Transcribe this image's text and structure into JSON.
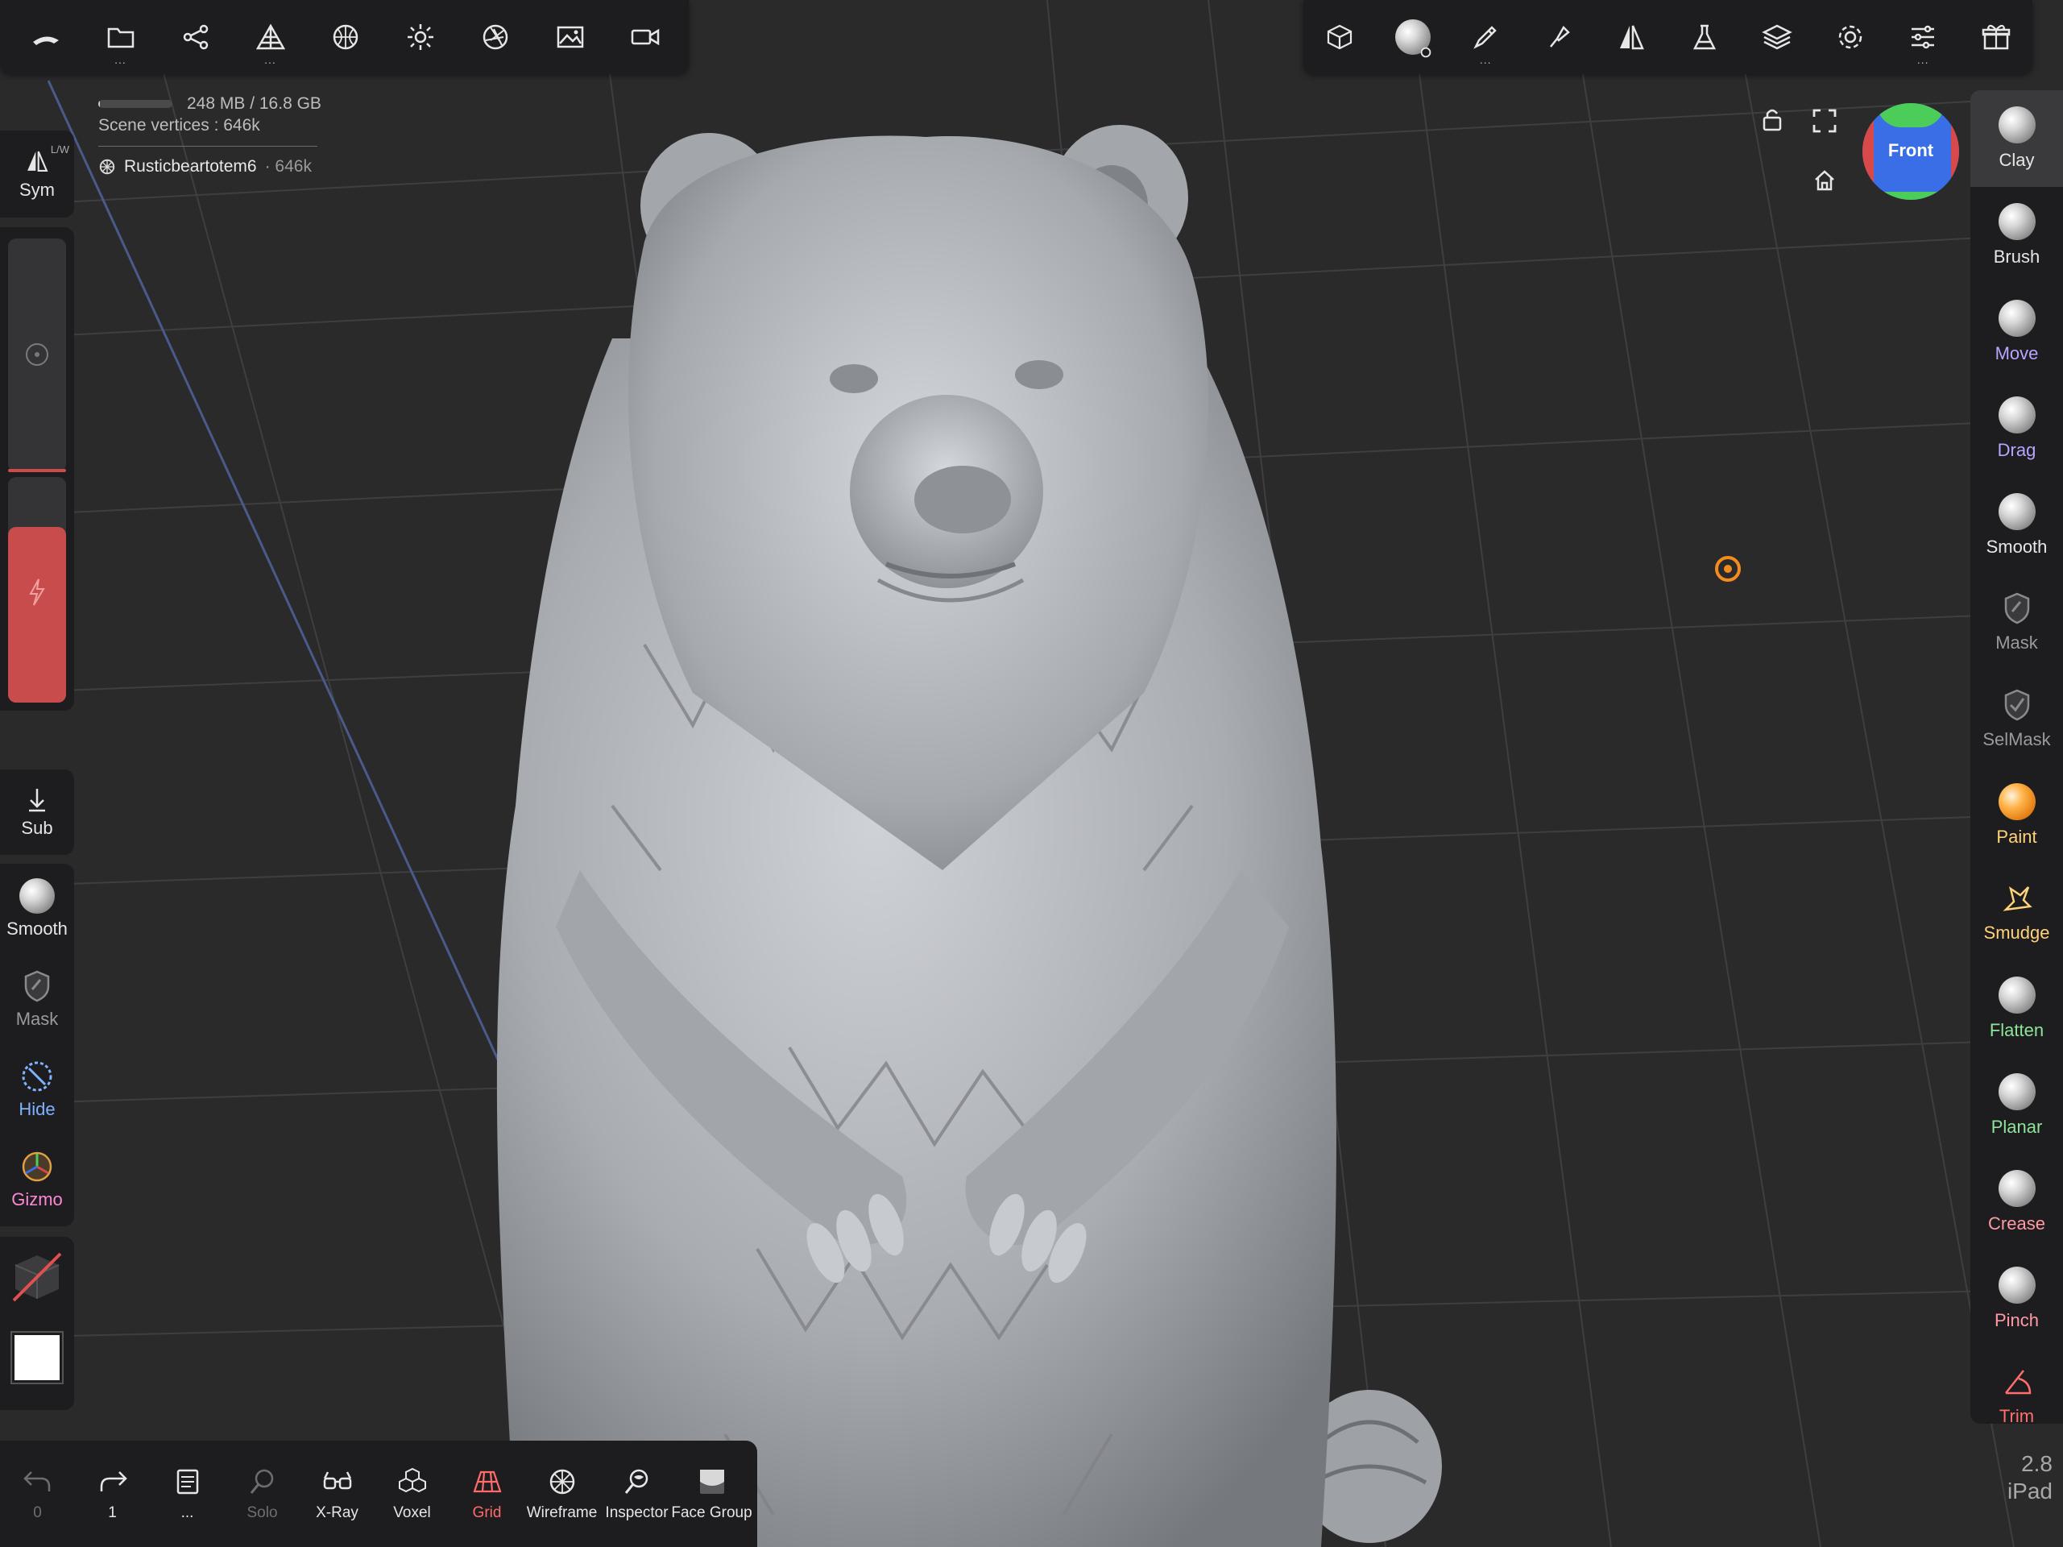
{
  "info": {
    "memory": "248 MB / 16.8 GB",
    "memory_fraction": 0.015,
    "scene_vertices": "Scene vertices : 646k",
    "object_name": "Rusticbeartotem6",
    "object_vertices": "· 646k"
  },
  "camera": {
    "view_label": "Front"
  },
  "left_panel": {
    "sym_label": "Sym",
    "sym_superscript": "L/W",
    "sub_label": "Sub",
    "tools": [
      {
        "label": "Smooth",
        "icon": "smooth-sphere-icon",
        "color": "#e6e6e6"
      },
      {
        "label": "Mask",
        "icon": "mask-icon",
        "color": "#9a9a9a"
      },
      {
        "label": "Hide",
        "icon": "hide-icon",
        "color": "#7fb2ff"
      },
      {
        "label": "Gizmo",
        "icon": "gizmo-icon",
        "color": "#ff88d6"
      }
    ]
  },
  "right_tools": [
    {
      "label": "Clay",
      "color": "#e6e6e6",
      "active": true
    },
    {
      "label": "Brush",
      "color": "#e6e6e6"
    },
    {
      "label": "Move",
      "color": "#b9a5ff"
    },
    {
      "label": "Drag",
      "color": "#b9a5ff"
    },
    {
      "label": "Smooth",
      "color": "#e6e6e6"
    },
    {
      "label": "Mask",
      "color": "#9a9a9a"
    },
    {
      "label": "SelMask",
      "color": "#9a9a9a"
    },
    {
      "label": "Paint",
      "color": "#ffd27a"
    },
    {
      "label": "Smudge",
      "color": "#ffd27a"
    },
    {
      "label": "Flatten",
      "color": "#8fe39a"
    },
    {
      "label": "Planar",
      "color": "#8fe39a"
    },
    {
      "label": "Crease",
      "color": "#ff9aa5"
    },
    {
      "label": "Pinch",
      "color": "#ff9aa5"
    },
    {
      "label": "Trim",
      "color": "#ff6d6d"
    }
  ],
  "bottom_bar": [
    {
      "label": "0",
      "icon": "undo-icon",
      "dim": true
    },
    {
      "label": "1",
      "icon": "redo-icon",
      "dim": false
    },
    {
      "label": "...",
      "icon": "history-icon",
      "dim": false
    },
    {
      "label": "Solo",
      "icon": "solo-icon",
      "dim": true
    },
    {
      "label": "X-Ray",
      "icon": "xray-icon",
      "dim": false
    },
    {
      "label": "Voxel",
      "icon": "voxel-icon",
      "dim": false
    },
    {
      "label": "Grid",
      "icon": "grid-icon",
      "dim": false,
      "accent": "#ff6b6b"
    },
    {
      "label": "Wireframe",
      "icon": "wireframe-icon",
      "dim": false
    },
    {
      "label": "Inspector",
      "icon": "inspector-icon",
      "dim": false
    },
    {
      "label": "Face Group",
      "icon": "face-group-icon",
      "dim": false
    }
  ],
  "version": {
    "number": "2.8",
    "device": "iPad"
  },
  "colors": {
    "panel": "#1d1d1f",
    "slider_red": "#c94c4c",
    "accent_orange": "#f28c1f"
  }
}
